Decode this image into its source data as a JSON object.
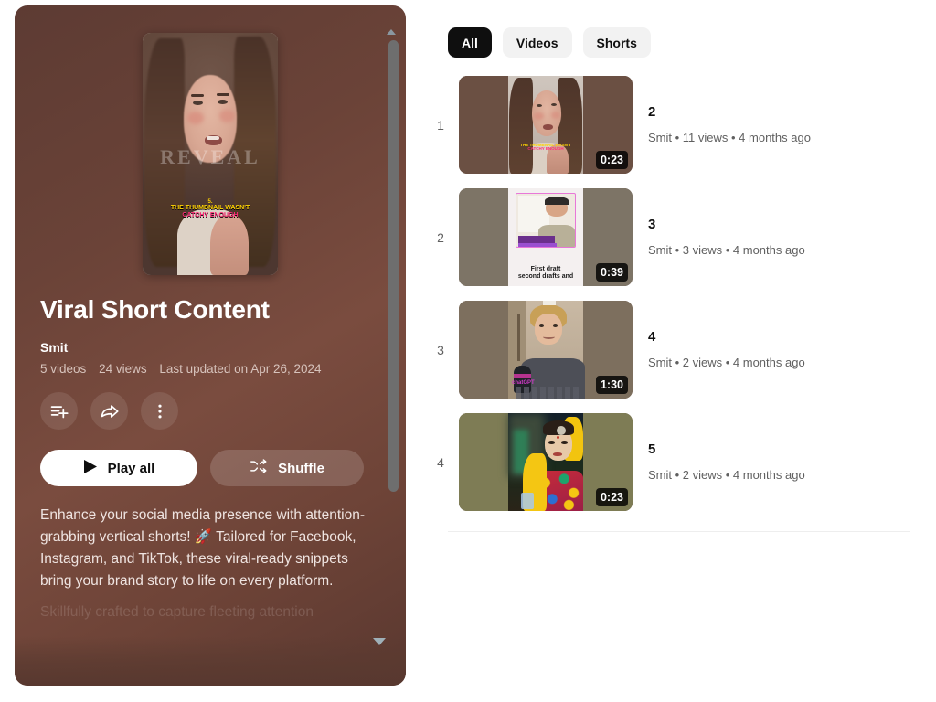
{
  "playlist": {
    "title": "Viral Short Content",
    "owner": "Smit",
    "video_count": "5 videos",
    "view_count": "24 views",
    "last_updated": "Last updated on Apr 26, 2024",
    "description": "Enhance your social media presence with attention-grabbing vertical shorts! 🚀 Tailored for Facebook, Instagram, and TikTok, these viral-ready snippets bring your brand story to life on every platform.",
    "description_next_line": "Skillfully crafted to capture fleeting attention",
    "hero_caption_line0": "5.",
    "hero_caption_line1": "THE THUMBNAIL WASN'T",
    "hero_caption_line2": "CATCHY ENOUGH",
    "hero_watermark": "REVEAL",
    "actions": {
      "save_label": "save-to-playlist",
      "share_label": "share",
      "more_label": "more-options"
    },
    "buttons": {
      "play_all": "Play all",
      "shuffle": "Shuffle"
    },
    "accent_background": "#6b4338"
  },
  "filters": {
    "chips": [
      {
        "label": "All",
        "active": true
      },
      {
        "label": "Videos",
        "active": false
      },
      {
        "label": "Shorts",
        "active": false
      }
    ]
  },
  "videos": [
    {
      "index": "1",
      "title": "2",
      "channel": "Smit",
      "views": "11 views",
      "age": "4 months ago",
      "meta": "Smit • 11 views • 4 months ago",
      "duration": "0:23",
      "thumb_caption_1": "THE THUMBNAIL WASN'T",
      "thumb_caption_2": "CATCHY ENOUGH",
      "thumb_bg": "#6b5043"
    },
    {
      "index": "2",
      "title": "3",
      "channel": "Smit",
      "views": "3 views",
      "age": "4 months ago",
      "meta": "Smit • 3 views • 4 months ago",
      "duration": "0:39",
      "thumb_caption_1": "First draft",
      "thumb_caption_highlight": "and",
      "thumb_caption_2": "second drafts and",
      "thumb_bg": "#7d7466"
    },
    {
      "index": "3",
      "title": "4",
      "channel": "Smit",
      "views": "2 views",
      "age": "4 months ago",
      "meta": "Smit • 2 views • 4 months ago",
      "duration": "1:30",
      "thumb_caption_1": "chatGPT",
      "thumb_bg": "#7d6f5e"
    },
    {
      "index": "4",
      "title": "5",
      "channel": "Smit",
      "views": "2 views",
      "age": "4 months ago",
      "meta": "Smit • 2 views • 4 months ago",
      "duration": "0:23",
      "thumb_bg": "#7e7c55"
    }
  ]
}
